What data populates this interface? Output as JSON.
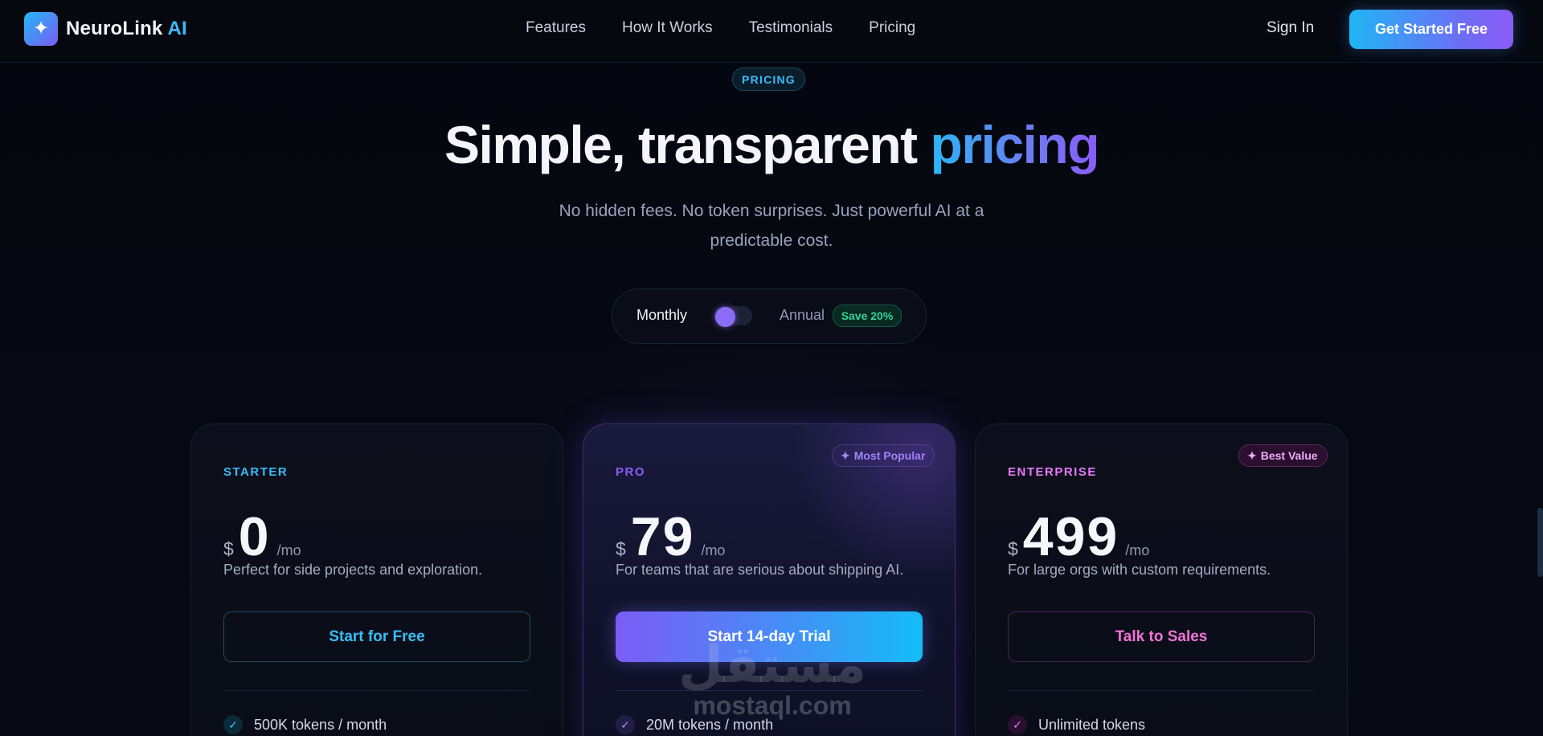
{
  "brand": {
    "name": "NeuroLink",
    "accent": "AI",
    "icon": "sparkles-icon"
  },
  "nav": {
    "links": [
      "Features",
      "How It Works",
      "Testimonials",
      "Pricing"
    ],
    "sign_in": "Sign In",
    "cta": "Get Started Free"
  },
  "hero": {
    "eyebrow": "PRICING",
    "title_main": "Simple, transparent",
    "title_accent": "pricing",
    "subtitle_line1": "No hidden fees. No token surprises. Just powerful AI at a",
    "subtitle_line2": "predictable cost."
  },
  "billing": {
    "monthly_label": "Monthly",
    "annual_label": "Annual",
    "save_badge": "Save 20%",
    "selected": "Monthly"
  },
  "plans": [
    {
      "tier": "STARTER",
      "currency": "$",
      "price": "0",
      "period": "/mo",
      "description": "Perfect for side projects and exploration.",
      "button": "Start for Free",
      "features": [
        "500K tokens / month"
      ],
      "color": "#38bdf8"
    },
    {
      "tier": "PRO",
      "badge": "Most Popular",
      "currency": "$",
      "price": "79",
      "period": "/mo",
      "description": "For teams that are serious about shipping AI.",
      "button": "Start 14-day Trial",
      "features": [
        "20M tokens / month"
      ],
      "color": "#8b5cf6"
    },
    {
      "tier": "ENTERPRISE",
      "badge": "Best Value",
      "currency": "$",
      "price": "499",
      "period": "/mo",
      "description": "For large orgs with custom requirements.",
      "button": "Talk to Sales",
      "features": [
        "Unlimited tokens"
      ],
      "color": "#e879f9"
    }
  ],
  "watermark": {
    "arabic": "مستقل",
    "latin": "mostaql.com"
  },
  "colors": {
    "background": "#05070f",
    "cyan": "#38bdf8",
    "violet": "#8b5cf6",
    "pink": "#e879f9",
    "green": "#34d399"
  }
}
